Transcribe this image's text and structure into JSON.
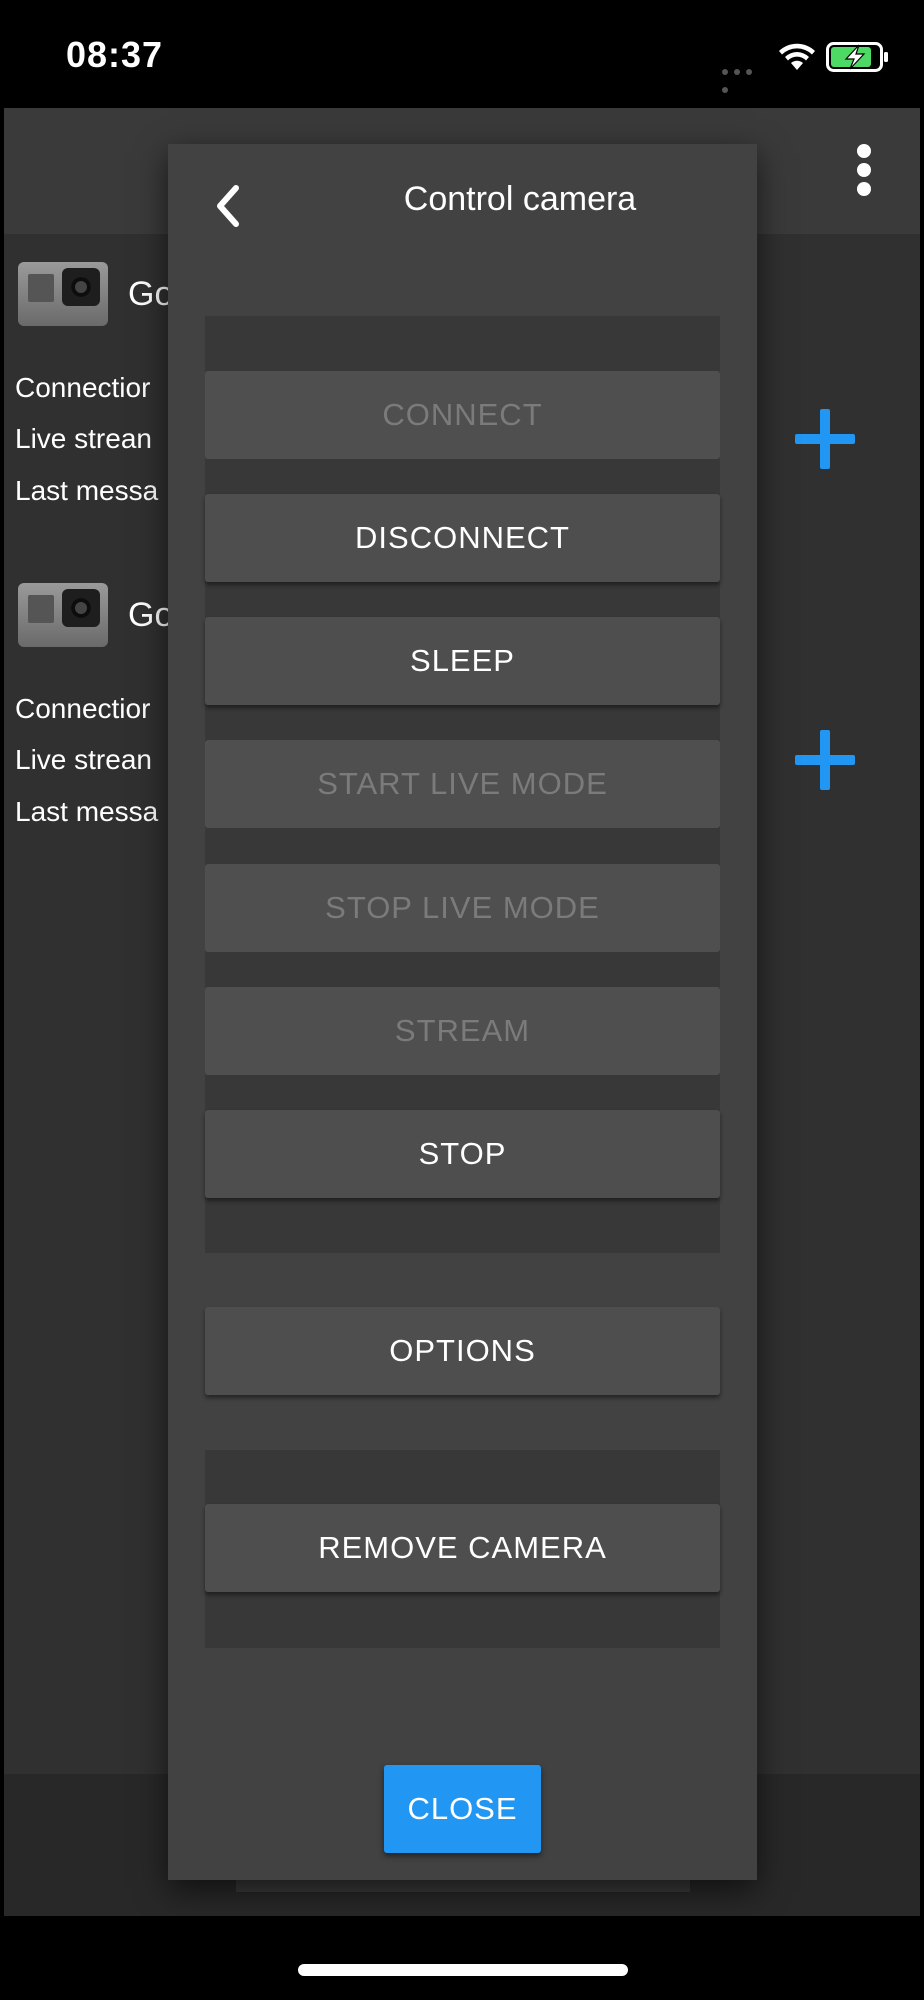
{
  "status_bar": {
    "time": "08:37",
    "icons": [
      "signal-dots-icon",
      "wifi-icon",
      "battery-charging-icon"
    ],
    "battery_color": "#4cd964"
  },
  "background": {
    "cameras": [
      {
        "name": "Go",
        "info": [
          "Connectior",
          "Live strean",
          "Last messa"
        ]
      },
      {
        "name": "Go",
        "info": [
          "Connectior",
          "Live strean",
          "Last messa"
        ]
      }
    ],
    "accent_color": "#2196f3"
  },
  "modal": {
    "title": "Control camera",
    "buttons": {
      "connect": "CONNECT",
      "disconnect": "DISCONNECT",
      "sleep": "SLEEP",
      "start_live_mode": "START LIVE MODE",
      "stop_live_mode": "STOP LIVE MODE",
      "stream": "STREAM",
      "stop": "STOP",
      "options": "OPTIONS",
      "remove_camera": "REMOVE CAMERA",
      "close": "CLOSE"
    },
    "disabled_buttons": [
      "CONNECT",
      "START LIVE MODE",
      "STOP LIVE MODE",
      "STREAM"
    ]
  }
}
